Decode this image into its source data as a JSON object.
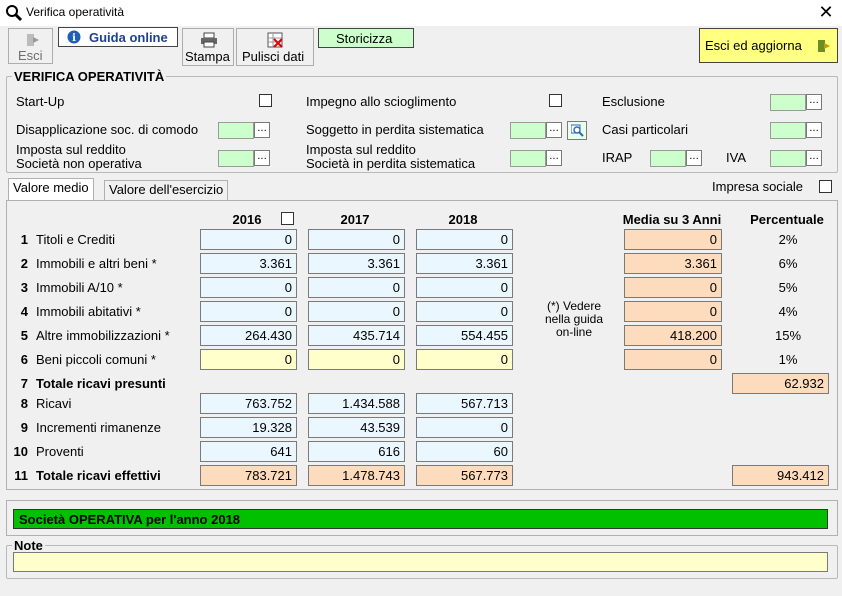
{
  "window": {
    "title": "Verifica operatività"
  },
  "toolbar": {
    "esci": "Esci",
    "guida": "Guida online",
    "stampa": "Stampa",
    "pulisci": "Pulisci dati",
    "storicizza": "Storicizza",
    "esci_aggiorna": "Esci ed aggiorna"
  },
  "verifica": {
    "title": "VERIFICA OPERATIVITÀ",
    "start_up": "Start-Up",
    "impegno": "Impegno allo scioglimento",
    "esclusione": "Esclusione",
    "disapplicazione": "Disapplicazione soc. di comodo",
    "soggetto": "Soggetto in perdita sistematica",
    "casi": "Casi particolari",
    "imposta_non_op_1": "Imposta sul reddito",
    "imposta_non_op_2": "Società non operativa",
    "imposta_perdita_1": "Imposta sul reddito",
    "imposta_perdita_2": "Società in perdita sistematica",
    "irap": "IRAP",
    "iva": "IVA",
    "dots": "..."
  },
  "tabs": {
    "medio": "Valore medio",
    "esercizio": "Valore dell'esercizio"
  },
  "impresa_sociale": "Impresa sociale",
  "table": {
    "headers": {
      "y2016": "2016",
      "y2017": "2017",
      "y2018": "2018",
      "media": "Media su 3 Anni",
      "perc": "Percentuale"
    },
    "note": [
      "(*) Vedere",
      "nella guida",
      "on-line"
    ],
    "rows": [
      {
        "n": "1",
        "label": "Titoli e Crediti",
        "v": [
          "0",
          "0",
          "0"
        ],
        "media": "0",
        "perc": "2%"
      },
      {
        "n": "2",
        "label": "Immobili e altri beni *",
        "v": [
          "3.361",
          "3.361",
          "3.361"
        ],
        "media": "3.361",
        "perc": "6%"
      },
      {
        "n": "3",
        "label": "Immobili A/10 *",
        "v": [
          "0",
          "0",
          "0"
        ],
        "media": "0",
        "perc": "5%"
      },
      {
        "n": "4",
        "label": "Immobili abitativi *",
        "v": [
          "0",
          "0",
          "0"
        ],
        "media": "0",
        "perc": "4%"
      },
      {
        "n": "5",
        "label": "Altre immobilizzazioni *",
        "v": [
          "264.430",
          "435.714",
          "554.455"
        ],
        "media": "418.200",
        "perc": "15%"
      },
      {
        "n": "6",
        "label": "Beni piccoli comuni *",
        "v": [
          "0",
          "0",
          "0"
        ],
        "media": "0",
        "perc": "1%"
      },
      {
        "n": "7",
        "label": "Totale ricavi presunti",
        "total": "62.932"
      },
      {
        "n": "8",
        "label": "Ricavi",
        "v": [
          "763.752",
          "1.434.588",
          "567.713"
        ]
      },
      {
        "n": "9",
        "label": "Incrementi rimanenze",
        "v": [
          "19.328",
          "43.539",
          "0"
        ]
      },
      {
        "n": "10",
        "label": "Proventi",
        "v": [
          "641",
          "616",
          "60"
        ]
      },
      {
        "n": "11",
        "label": "Totale ricavi effettivi",
        "v": [
          "783.721",
          "1.478.743",
          "567.773"
        ],
        "total": "943.412"
      }
    ]
  },
  "status": "Società OPERATIVA per l'anno 2018",
  "note_title": "Note",
  "colors": {
    "green_status": "#00c000",
    "field_green": "#ccffcc",
    "field_blue": "#eaf7ff",
    "field_yellow": "#ffffcc",
    "field_orange": "#fddcbd",
    "btn_green": "#ccffcc",
    "btn_yellow": "#ffff80"
  }
}
